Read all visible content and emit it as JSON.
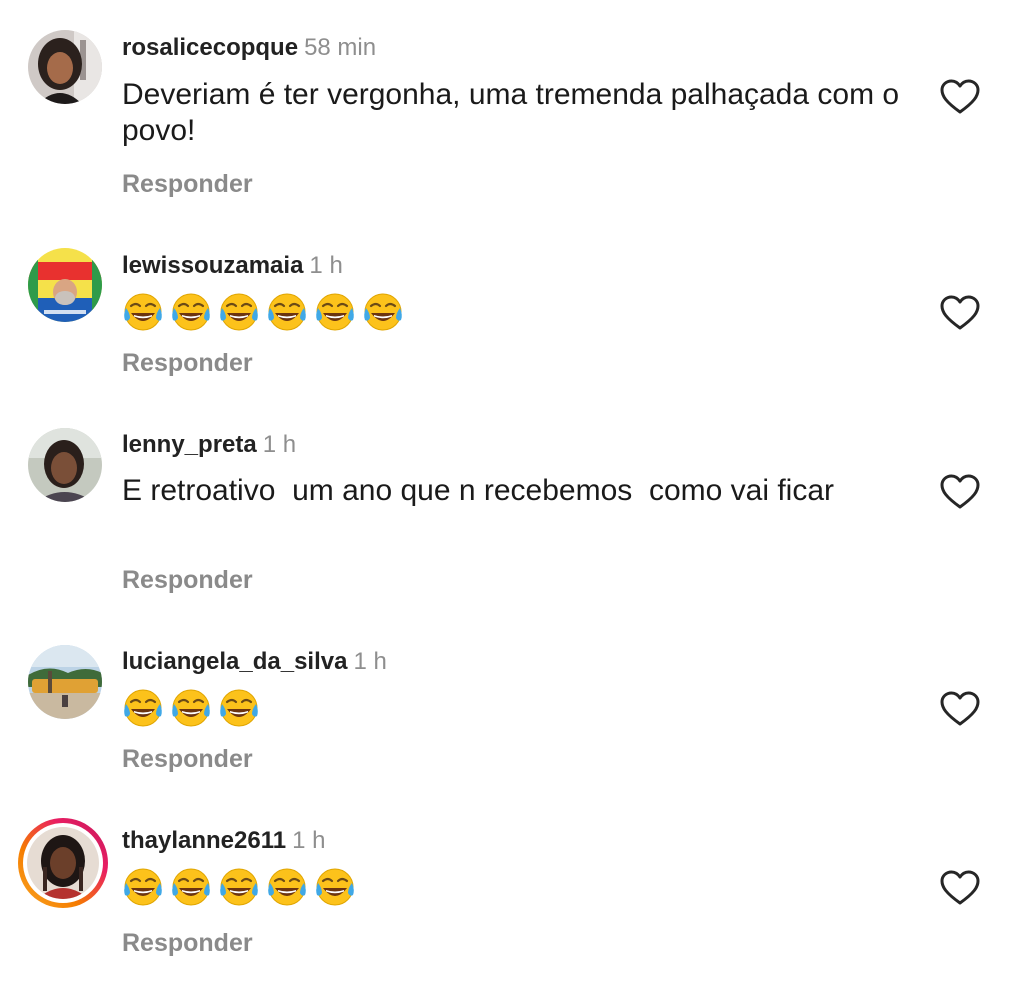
{
  "comments": [
    {
      "username": "rosalicecopque",
      "time": "58 min",
      "text": "Deveriam é ter vergonha, uma tremenda palhaçada com o povo!",
      "emoji_count": 0,
      "reply_label": "Responder",
      "avatar_icon": "profile-photo",
      "like_icon": "heart-outline-icon"
    },
    {
      "username": "lewissouzamaia",
      "time": "1 h",
      "text": "",
      "emoji_count": 6,
      "emoji": "face-with-tears-of-joy",
      "reply_label": "Responder",
      "avatar_icon": "profile-photo-lula-poster",
      "like_icon": "heart-outline-icon"
    },
    {
      "username": "lenny_preta",
      "time": "1 h",
      "text": "E retroativo  um ano que n recebemos  como vai ficar",
      "emoji_count": 0,
      "reply_label": "Responder",
      "avatar_icon": "profile-photo",
      "like_icon": "heart-outline-icon"
    },
    {
      "username": "luciangela_da_silva",
      "time": "1 h",
      "text": "",
      "emoji_count": 3,
      "emoji": "face-with-tears-of-joy",
      "reply_label": "Responder",
      "avatar_icon": "profile-photo-landscape",
      "like_icon": "heart-outline-icon"
    },
    {
      "username": "thaylanne2611",
      "time": "1 h",
      "text": "",
      "emoji_count": 5,
      "emoji": "face-with-tears-of-joy",
      "reply_label": "Responder",
      "avatar_icon": "profile-photo-story-ring",
      "like_icon": "heart-outline-icon"
    }
  ],
  "colors": {
    "username": "#222222",
    "timestamp": "#8e8e8e",
    "reply": "#8a8a8a",
    "story_ring_start": "#f9a825",
    "story_ring_end": "#c2185b"
  }
}
